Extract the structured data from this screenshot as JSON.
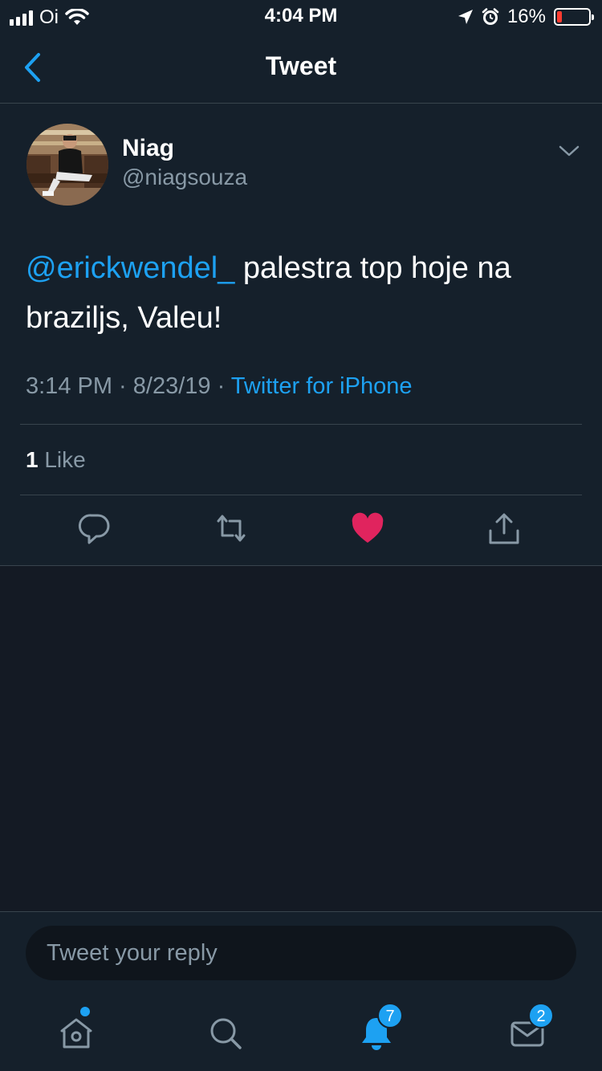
{
  "status_bar": {
    "carrier": "Oi",
    "time": "4:04 PM",
    "battery": "16%",
    "battery_level": 0.16,
    "icons": [
      "signal-icon",
      "wifi-icon",
      "location-icon",
      "alarm-icon",
      "battery-icon"
    ]
  },
  "nav": {
    "title": "Tweet",
    "back_icon": "chevron-left-icon"
  },
  "tweet": {
    "author_name": "Niag",
    "author_handle": "@niagsouza",
    "mention": "@erickwendel_",
    "text": " palestra top hoje na braziljs, Valeu!",
    "time": "3:14 PM",
    "date": "8/23/19",
    "source": "Twitter for iPhone",
    "sep": " · ",
    "like_count": "1",
    "like_label": " Like"
  },
  "actions": [
    "reply-icon",
    "retweet-icon",
    "heart-icon",
    "share-icon"
  ],
  "reply": {
    "placeholder": "Tweet your reply"
  },
  "tabs": [
    {
      "name": "home",
      "icon": "home-icon",
      "badge": ""
    },
    {
      "name": "search",
      "icon": "search-icon",
      "badge": ""
    },
    {
      "name": "notifications",
      "icon": "bell-icon",
      "badge": "7"
    },
    {
      "name": "messages",
      "icon": "mail-icon",
      "badge": "2"
    }
  ],
  "colors": {
    "background": "#15202b",
    "accent": "#1da1f2",
    "secondary_text": "#8899a6",
    "like": "#e0245e"
  }
}
